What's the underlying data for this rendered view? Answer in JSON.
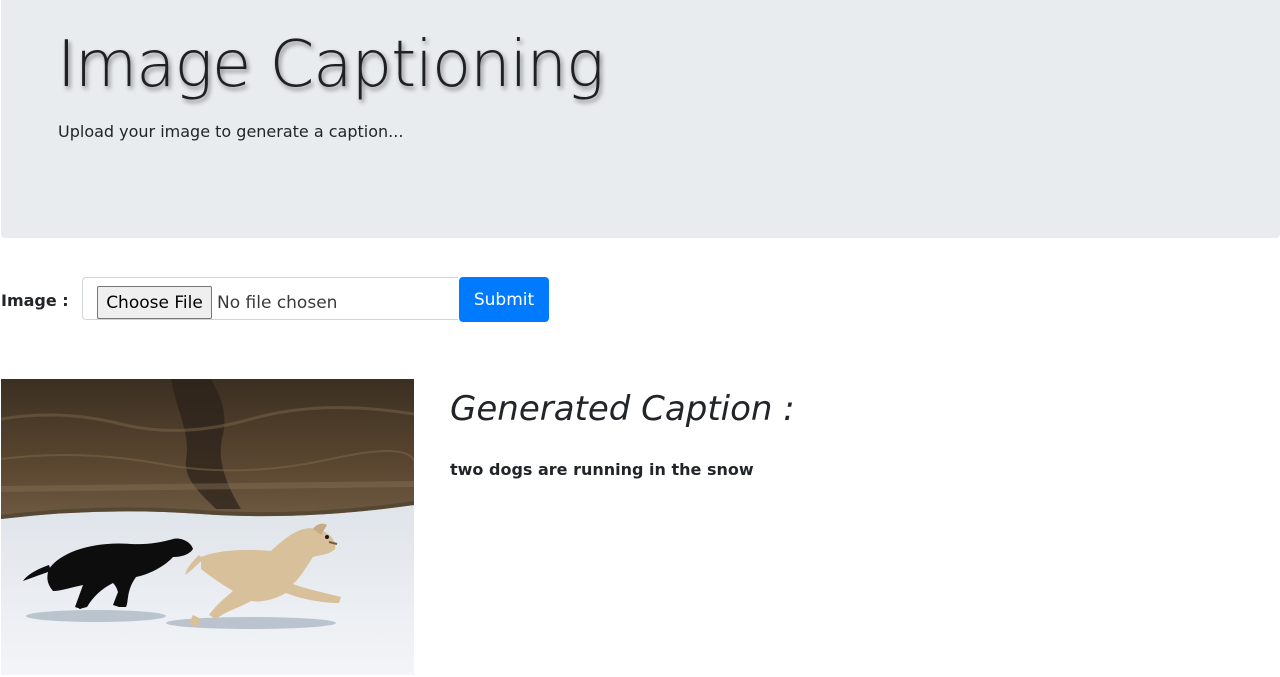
{
  "header": {
    "title": "Image Captioning",
    "subtitle": "Upload your image to generate a caption..."
  },
  "form": {
    "image_label": "Image :",
    "choose_file_label": "Choose File",
    "no_file_text": "No file chosen",
    "submit_label": "Submit"
  },
  "result": {
    "heading": "Generated Caption :",
    "caption": "two dogs are running in the snow"
  },
  "colors": {
    "jumbotron_bg": "#e9ecef",
    "primary": "#007bff",
    "text": "#212529"
  }
}
